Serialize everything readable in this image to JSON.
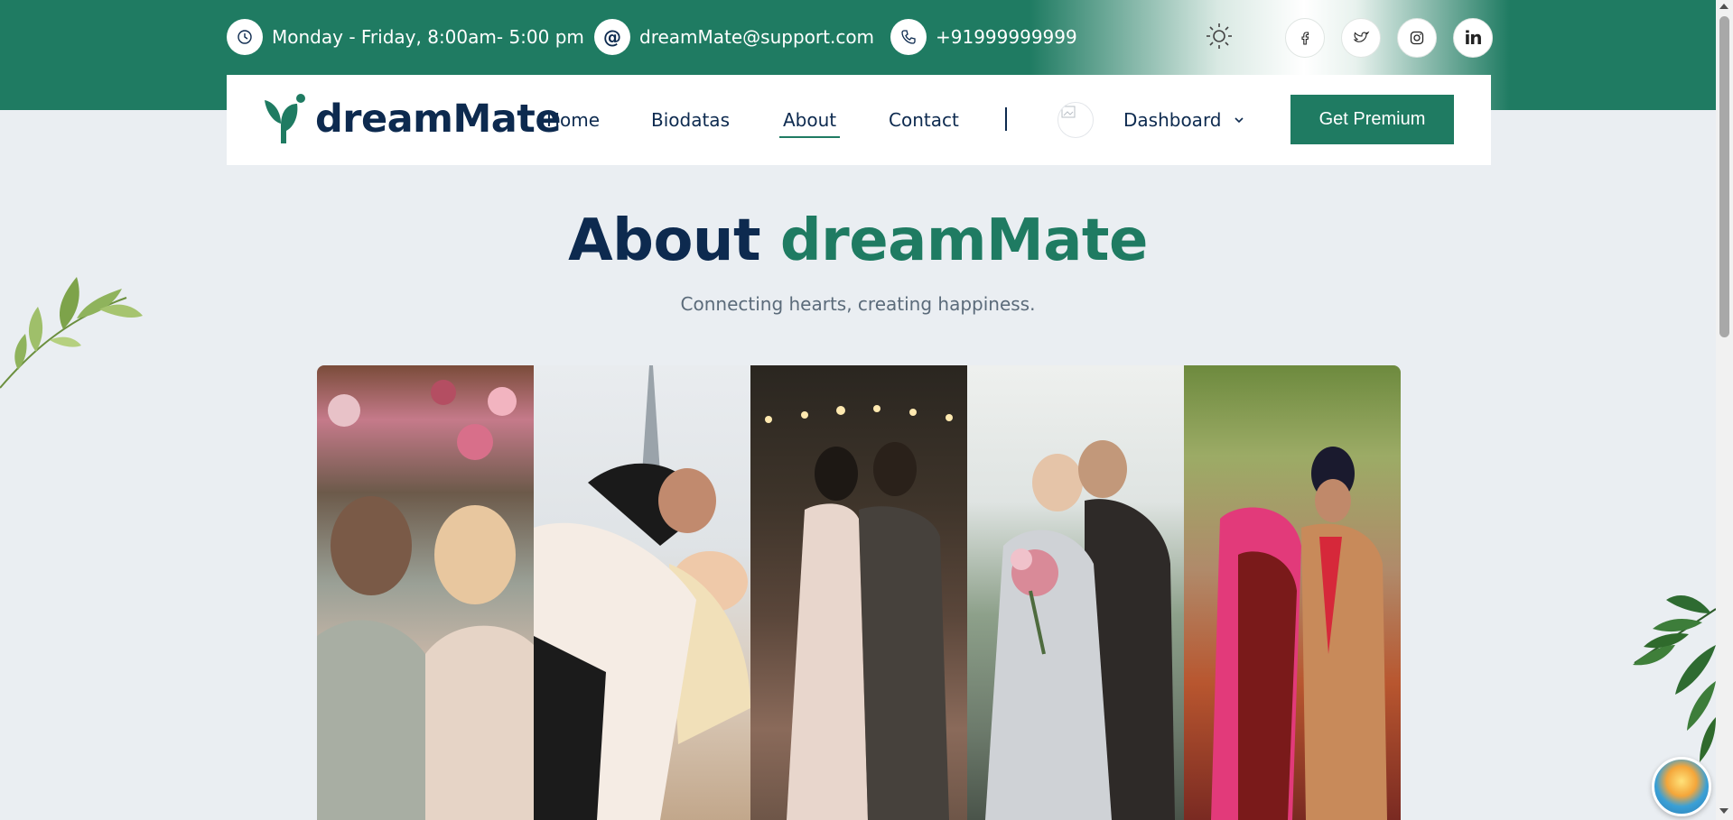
{
  "topbar": {
    "hours": "Monday - Friday, 8:00am- 5:00 pm",
    "email": "dreamMate@support.com",
    "phone": "+91999999999",
    "socials": [
      "facebook-icon",
      "twitter-icon",
      "instagram-icon",
      "linkedin-icon"
    ]
  },
  "nav": {
    "logo": "dreamMate",
    "links": [
      "Home",
      "Biodatas",
      "About",
      "Contact"
    ],
    "active": "About",
    "dashboard": "Dashboard",
    "cta": "Get Premium"
  },
  "hero": {
    "title_part1": "About",
    "title_part2": "dreamMate",
    "subtitle": "Connecting hearts, creating happiness."
  },
  "colors": {
    "primary": "#1f7b62",
    "navy": "#0d2a4f",
    "background": "#eaeef2"
  },
  "gallery": [
    "couple-photo-1",
    "couple-photo-2",
    "couple-photo-3",
    "couple-photo-4",
    "couple-photo-5"
  ]
}
